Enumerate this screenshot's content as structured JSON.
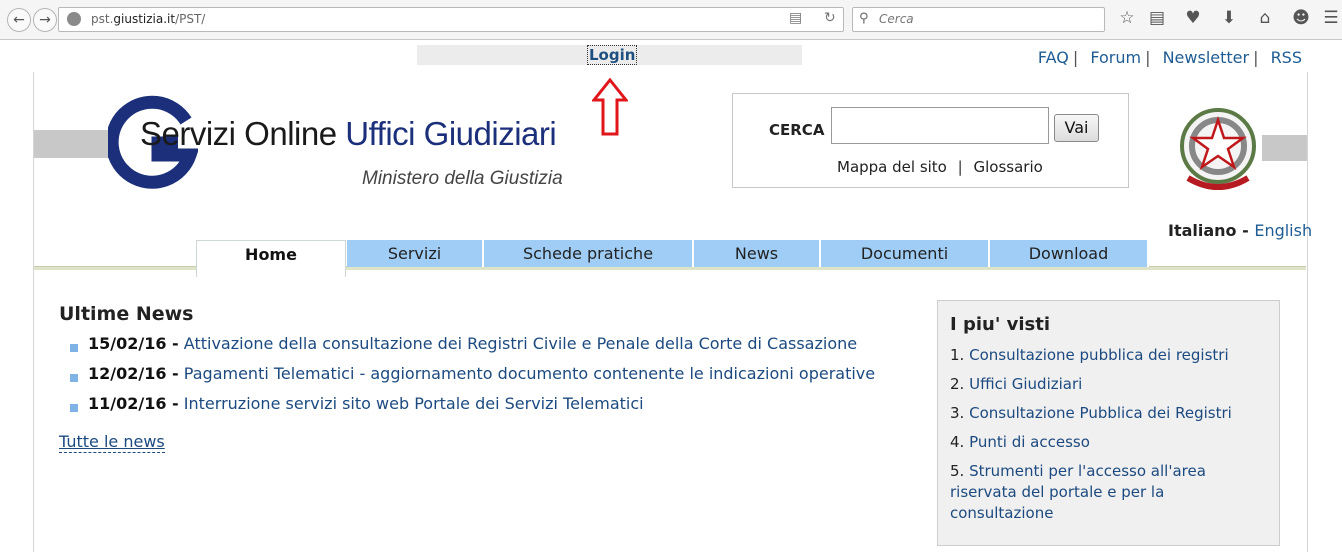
{
  "browser": {
    "url_prefix": "pst.",
    "url_domain": "giustizia.it",
    "url_path": "/PST/",
    "search_placeholder": "Cerca"
  },
  "top": {
    "login_label": "Login",
    "links": [
      "FAQ",
      "Forum",
      "Newsletter",
      "RSS"
    ],
    "sep": "|"
  },
  "logo": {
    "title_part1": "Servizi Online ",
    "title_part2": "Uffici Giudiziari",
    "subtitle": "Ministero della Giustizia"
  },
  "search": {
    "label": "CERCA",
    "button": "Vai",
    "sitemap": "Mappa del sito",
    "sep": "|",
    "glossary": "Glossario"
  },
  "lang": {
    "current": "Italiano",
    "dash": " - ",
    "other": "English"
  },
  "tabs": [
    "Home",
    "Servizi",
    "Schede pratiche",
    "News",
    "Documenti",
    "Download"
  ],
  "news": {
    "heading": "Ultime News",
    "items": [
      {
        "date": "15/02/16 -",
        "title": "Attivazione della consultazione dei Registri Civile e Penale della Corte di Cassazione"
      },
      {
        "date": "12/02/16 -",
        "title": "Pagamenti Telematici - aggiornamento documento contenente le indicazioni operative"
      },
      {
        "date": "11/02/16 -",
        "title": "Interruzione servizi sito web Portale dei Servizi Telematici"
      }
    ],
    "all_label": "Tutte le news"
  },
  "most_viewed": {
    "heading": "I piu' visti",
    "items": [
      {
        "num": "1.",
        "label": "Consultazione pubblica dei registri"
      },
      {
        "num": "2.",
        "label": "Uffici Giudiziari"
      },
      {
        "num": "3.",
        "label": "Consultazione Pubblica dei Registri"
      },
      {
        "num": "4.",
        "label": "Punti di accesso"
      },
      {
        "num": "5.",
        "label": "Strumenti per l'accesso all'area riservata del portale e per la consultazione"
      }
    ]
  },
  "colors": {
    "link": "#1c4a80",
    "tab": "#9fcdf5",
    "arrow": "#e0161b",
    "logo_blue": "#1b2f7a"
  }
}
